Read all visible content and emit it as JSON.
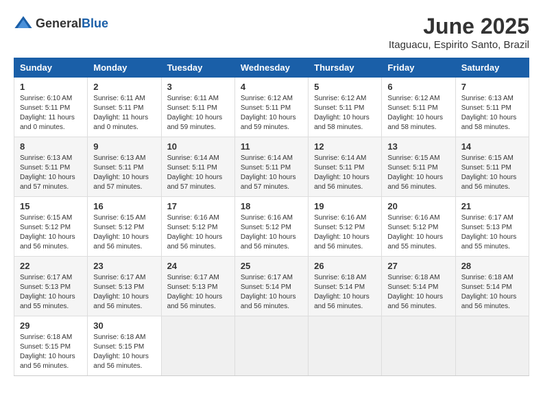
{
  "header": {
    "logo_general": "General",
    "logo_blue": "Blue",
    "month_title": "June 2025",
    "location": "Itaguacu, Espirito Santo, Brazil"
  },
  "days_of_week": [
    "Sunday",
    "Monday",
    "Tuesday",
    "Wednesday",
    "Thursday",
    "Friday",
    "Saturday"
  ],
  "weeks": [
    [
      {
        "day": "1",
        "sunrise": "6:10 AM",
        "sunset": "5:11 PM",
        "daylight": "11 hours and 0 minutes."
      },
      {
        "day": "2",
        "sunrise": "6:11 AM",
        "sunset": "5:11 PM",
        "daylight": "11 hours and 0 minutes."
      },
      {
        "day": "3",
        "sunrise": "6:11 AM",
        "sunset": "5:11 PM",
        "daylight": "10 hours and 59 minutes."
      },
      {
        "day": "4",
        "sunrise": "6:12 AM",
        "sunset": "5:11 PM",
        "daylight": "10 hours and 59 minutes."
      },
      {
        "day": "5",
        "sunrise": "6:12 AM",
        "sunset": "5:11 PM",
        "daylight": "10 hours and 58 minutes."
      },
      {
        "day": "6",
        "sunrise": "6:12 AM",
        "sunset": "5:11 PM",
        "daylight": "10 hours and 58 minutes."
      },
      {
        "day": "7",
        "sunrise": "6:13 AM",
        "sunset": "5:11 PM",
        "daylight": "10 hours and 58 minutes."
      }
    ],
    [
      {
        "day": "8",
        "sunrise": "6:13 AM",
        "sunset": "5:11 PM",
        "daylight": "10 hours and 57 minutes."
      },
      {
        "day": "9",
        "sunrise": "6:13 AM",
        "sunset": "5:11 PM",
        "daylight": "10 hours and 57 minutes."
      },
      {
        "day": "10",
        "sunrise": "6:14 AM",
        "sunset": "5:11 PM",
        "daylight": "10 hours and 57 minutes."
      },
      {
        "day": "11",
        "sunrise": "6:14 AM",
        "sunset": "5:11 PM",
        "daylight": "10 hours and 57 minutes."
      },
      {
        "day": "12",
        "sunrise": "6:14 AM",
        "sunset": "5:11 PM",
        "daylight": "10 hours and 56 minutes."
      },
      {
        "day": "13",
        "sunrise": "6:15 AM",
        "sunset": "5:11 PM",
        "daylight": "10 hours and 56 minutes."
      },
      {
        "day": "14",
        "sunrise": "6:15 AM",
        "sunset": "5:11 PM",
        "daylight": "10 hours and 56 minutes."
      }
    ],
    [
      {
        "day": "15",
        "sunrise": "6:15 AM",
        "sunset": "5:12 PM",
        "daylight": "10 hours and 56 minutes."
      },
      {
        "day": "16",
        "sunrise": "6:15 AM",
        "sunset": "5:12 PM",
        "daylight": "10 hours and 56 minutes."
      },
      {
        "day": "17",
        "sunrise": "6:16 AM",
        "sunset": "5:12 PM",
        "daylight": "10 hours and 56 minutes."
      },
      {
        "day": "18",
        "sunrise": "6:16 AM",
        "sunset": "5:12 PM",
        "daylight": "10 hours and 56 minutes."
      },
      {
        "day": "19",
        "sunrise": "6:16 AM",
        "sunset": "5:12 PM",
        "daylight": "10 hours and 56 minutes."
      },
      {
        "day": "20",
        "sunrise": "6:16 AM",
        "sunset": "5:12 PM",
        "daylight": "10 hours and 55 minutes."
      },
      {
        "day": "21",
        "sunrise": "6:17 AM",
        "sunset": "5:13 PM",
        "daylight": "10 hours and 55 minutes."
      }
    ],
    [
      {
        "day": "22",
        "sunrise": "6:17 AM",
        "sunset": "5:13 PM",
        "daylight": "10 hours and 55 minutes."
      },
      {
        "day": "23",
        "sunrise": "6:17 AM",
        "sunset": "5:13 PM",
        "daylight": "10 hours and 56 minutes."
      },
      {
        "day": "24",
        "sunrise": "6:17 AM",
        "sunset": "5:13 PM",
        "daylight": "10 hours and 56 minutes."
      },
      {
        "day": "25",
        "sunrise": "6:17 AM",
        "sunset": "5:14 PM",
        "daylight": "10 hours and 56 minutes."
      },
      {
        "day": "26",
        "sunrise": "6:18 AM",
        "sunset": "5:14 PM",
        "daylight": "10 hours and 56 minutes."
      },
      {
        "day": "27",
        "sunrise": "6:18 AM",
        "sunset": "5:14 PM",
        "daylight": "10 hours and 56 minutes."
      },
      {
        "day": "28",
        "sunrise": "6:18 AM",
        "sunset": "5:14 PM",
        "daylight": "10 hours and 56 minutes."
      }
    ],
    [
      {
        "day": "29",
        "sunrise": "6:18 AM",
        "sunset": "5:15 PM",
        "daylight": "10 hours and 56 minutes."
      },
      {
        "day": "30",
        "sunrise": "6:18 AM",
        "sunset": "5:15 PM",
        "daylight": "10 hours and 56 minutes."
      },
      null,
      null,
      null,
      null,
      null
    ]
  ]
}
